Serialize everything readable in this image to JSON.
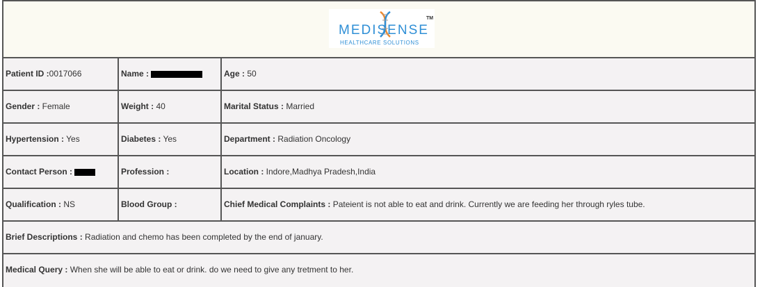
{
  "logo": {
    "brand": "MEDISENSE",
    "tagline": "HEALTHCARE SOLUTIONS",
    "tm": "TM",
    "colors": {
      "blue": "#2f8fd6",
      "orange": "#f08a2c"
    }
  },
  "rows": [
    {
      "c1": {
        "label": "Patient ID :",
        "value": "0017066"
      },
      "c2": {
        "label": "Name :",
        "value": ""
      },
      "c3": {
        "label": "Age :",
        "value": " 50"
      }
    },
    {
      "c1": {
        "label": "Gender :",
        "value": " Female"
      },
      "c2": {
        "label": "Weight :",
        "value": " 40"
      },
      "c3": {
        "label": "Marital Status :",
        "value": " Married"
      }
    },
    {
      "c1": {
        "label": "Hypertension :",
        "value": " Yes"
      },
      "c2": {
        "label": "Diabetes :",
        "value": " Yes"
      },
      "c3": {
        "label": "Department :",
        "value": " Radiation Oncology"
      }
    },
    {
      "c1": {
        "label": "Contact Person :",
        "value": ""
      },
      "c2": {
        "label": "Profession :",
        "value": ""
      },
      "c3": {
        "label": "Location :",
        "value": " Indore,Madhya Pradesh,India"
      }
    },
    {
      "c1": {
        "label": "Qualification :",
        "value": " NS"
      },
      "c2": {
        "label": "Blood Group :",
        "value": ""
      },
      "c3": {
        "label": "Chief Medical Complaints :",
        "value": " Pateient is not able to eat and drink. Currently we are feeding her through ryles tube."
      }
    }
  ],
  "brief": {
    "label": "Brief Descriptions :",
    "value": " Radiation and chemo has been completed by the end of january."
  },
  "query": {
    "label": "Medical Query :",
    "value": " When she will be able to eat or drink. do we need to give any tretment to her."
  }
}
